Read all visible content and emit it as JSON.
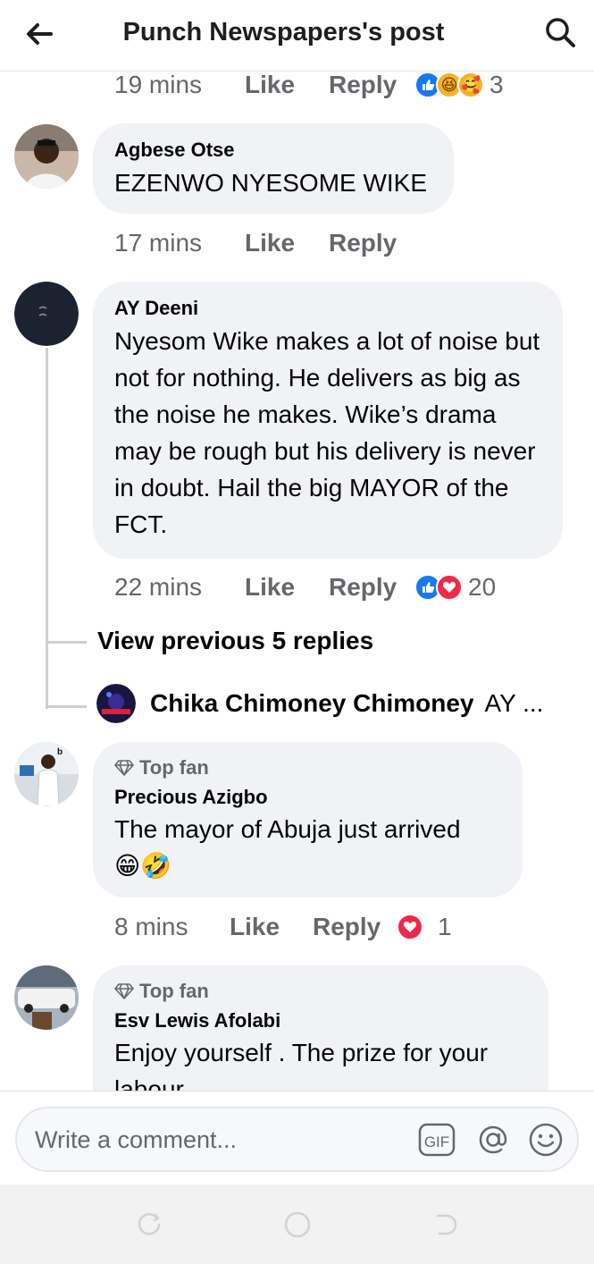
{
  "header": {
    "title": "Punch Newspapers's post",
    "back_icon": "arrow-left-icon",
    "search_icon": "search-icon"
  },
  "comments": [
    {
      "time": "19 mins",
      "like": "Like",
      "reply": "Reply",
      "reactions": [
        "like",
        "haha",
        "care"
      ],
      "reaction_count": "3"
    },
    {
      "author": "Agbese Otse",
      "text": "EZENWO NYESOME WIKE",
      "time": "17 mins",
      "like": "Like",
      "reply": "Reply"
    },
    {
      "author": "AY Deeni",
      "text": "Nyesom Wike makes a lot of noise but not for nothing. He delivers as big as the noise he makes. Wike’s drama may be rough but his delivery is never in doubt. Hail the big MAYOR of the FCT.",
      "time": "22 mins",
      "like": "Like",
      "reply": "Reply",
      "reactions": [
        "like",
        "love"
      ],
      "reaction_count": "20",
      "view_previous": "View previous 5 replies",
      "latest_reply": {
        "author": "Chika Chimoney Chimoney",
        "snippet": "AY ..."
      }
    },
    {
      "badge": "Top fan",
      "author": "Precious Azigbo",
      "text": "The mayor of Abuja just arrived",
      "emojis": [
        "😁",
        "🤣"
      ],
      "time": "8 mins",
      "like": "Like",
      "reply": "Reply",
      "reactions": [
        "love"
      ],
      "reaction_count": "1"
    },
    {
      "badge": "Top fan",
      "author": "Esv Lewis Afolabi",
      "text": "Enjoy yourself . The prize for your labour"
    }
  ],
  "composer": {
    "placeholder": "Write a comment...",
    "gif_label": "GIF",
    "icons": [
      "gif-icon",
      "mention-icon",
      "emoji-icon"
    ]
  },
  "navbar": {
    "icons": [
      "recents-icon",
      "home-icon",
      "back-icon"
    ]
  },
  "colors": {
    "accent": "#1877f2",
    "love": "#f02849",
    "bubble": "#f0f2f5",
    "secondary_text": "#65676b"
  }
}
